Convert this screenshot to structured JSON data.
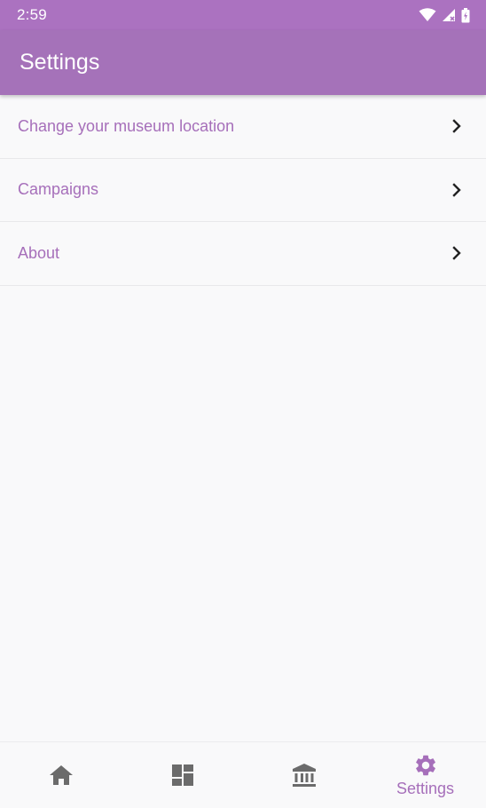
{
  "status_bar": {
    "time": "2:59",
    "icons": [
      "wifi-icon",
      "signal-icon",
      "battery-icon"
    ]
  },
  "app_bar": {
    "title": "Settings"
  },
  "settings": {
    "items": [
      {
        "label": "Change your museum location",
        "icon": "chevron-right-icon"
      },
      {
        "label": "Campaigns",
        "icon": "chevron-right-icon"
      },
      {
        "label": "About",
        "icon": "chevron-right-icon"
      }
    ]
  },
  "bottom_nav": {
    "items": [
      {
        "icon": "home-icon",
        "label": ""
      },
      {
        "icon": "dashboard-icon",
        "label": ""
      },
      {
        "icon": "museum-icon",
        "label": ""
      },
      {
        "icon": "gear-icon",
        "label": "Settings",
        "active": true
      }
    ]
  },
  "colors": {
    "status_bar": "#ab72c0",
    "app_bar": "#a572b9",
    "accent": "#a66fba",
    "inactive_icon": "#6b6b6b",
    "background": "#f9f9fa"
  }
}
